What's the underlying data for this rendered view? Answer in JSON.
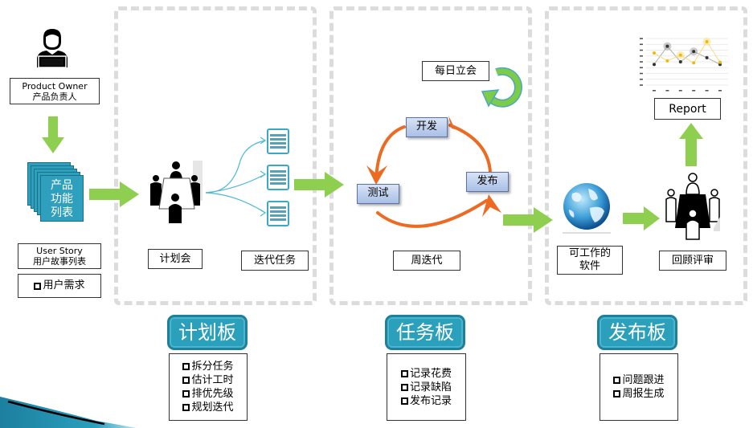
{
  "left": {
    "product_owner": {
      "line1": "Product Owner",
      "line2": "产品负责人"
    },
    "backlog_stack": {
      "line1": "产品",
      "line2": "功能",
      "line3": "列表"
    },
    "user_story": {
      "line1": "User Story",
      "line2": "用户故事列表"
    },
    "requirements": {
      "item": "用户需求"
    }
  },
  "planning": {
    "meeting_label": "计划会",
    "tasks_label": "迭代任务",
    "board": {
      "title": "计划板",
      "items": [
        "拆分任务",
        "估计工时",
        "排优先级",
        "规划迭代"
      ]
    }
  },
  "iteration": {
    "daily_standup": "每日立会",
    "cycle_nodes": {
      "develop": "开发",
      "test": "测试",
      "release": "发布"
    },
    "label": "周迭代",
    "board": {
      "title": "任务板",
      "items": [
        "记录花费",
        "记录缺陷",
        "发布记录"
      ]
    }
  },
  "release": {
    "software_label": {
      "line1": "可工作的",
      "line2": "软件"
    },
    "review_label": "回顾评审",
    "report_label": "Report",
    "board": {
      "title": "发布板",
      "items": [
        "问题跟进",
        "周报生成"
      ]
    }
  },
  "colors": {
    "arrow_green": "#8fcf4f",
    "cycle_orange": "#ec6a22",
    "board_teal": "#2aa0bc",
    "standup_green": "#7ccc4a"
  },
  "chart_data": {
    "type": "line",
    "title": "",
    "series": [
      {
        "name": "dark",
        "values": [
          4,
          7.5,
          4.5,
          6.5,
          5.3,
          4
        ]
      },
      {
        "name": "yellow",
        "values": [
          6.2,
          4.7,
          5.8,
          4.3,
          8.4,
          4.4
        ]
      }
    ],
    "ylim": [
      0,
      9
    ]
  }
}
